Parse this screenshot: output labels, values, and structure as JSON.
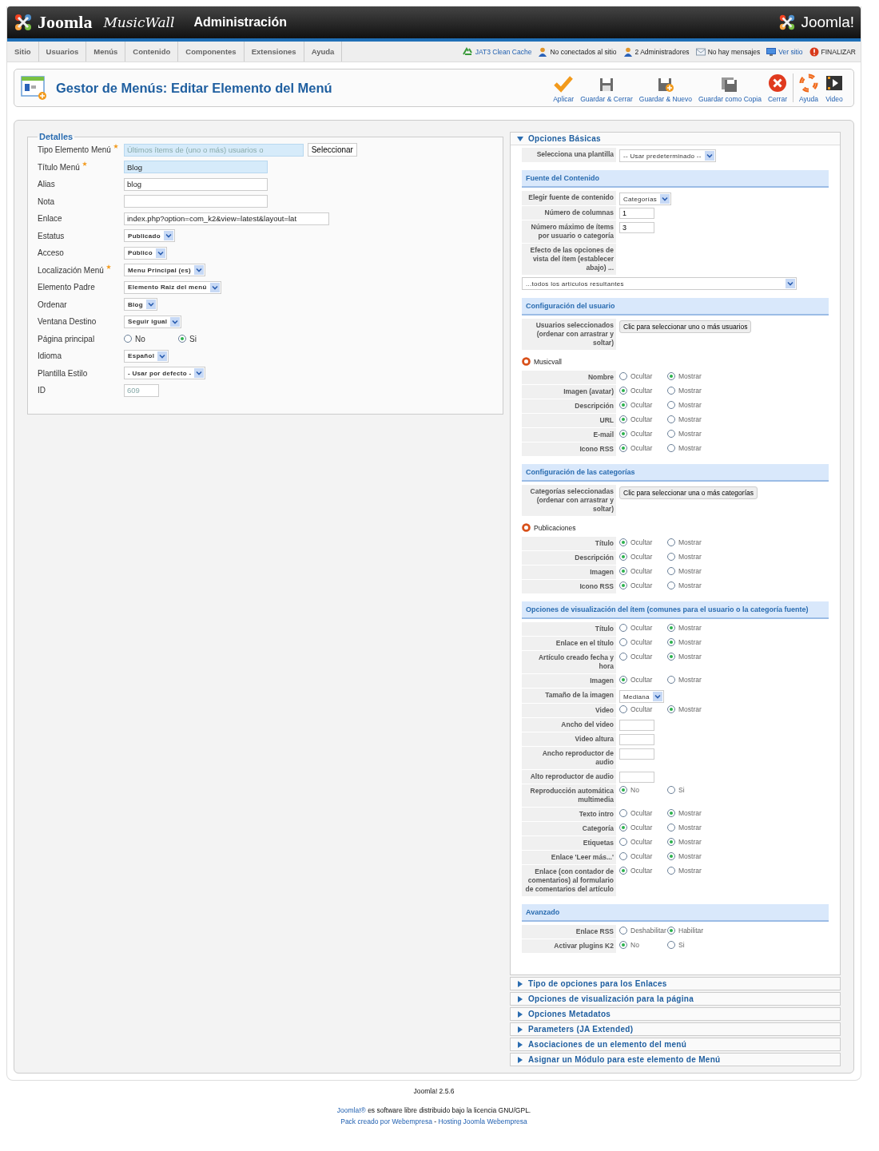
{
  "header": {
    "brand": "Joomla",
    "site_logo": "MusicWall",
    "title": "Administración",
    "right_logo": "Joomla!"
  },
  "menu": [
    "Sitio",
    "Usuarios",
    "Menús",
    "Contenido",
    "Componentes",
    "Extensiones",
    "Ayuda"
  ],
  "status": [
    {
      "label": "JAT3 Clean Cache",
      "kind": "link"
    },
    {
      "label": "No conectados al sitio",
      "kind": "text"
    },
    {
      "label": "2 Administradores",
      "kind": "text"
    },
    {
      "label": "No hay mensajes",
      "kind": "text"
    },
    {
      "label": "Ver sitio",
      "kind": "link"
    },
    {
      "label": "FINALIZAR",
      "kind": "text"
    }
  ],
  "toolbar": {
    "title": "Gestor de Menús: Editar Elemento del Menú",
    "buttons": [
      {
        "label": "Aplicar"
      },
      {
        "label": "Guardar & Cerrar"
      },
      {
        "label": "Guardar & Nuevo"
      },
      {
        "label": "Guardar como Copia"
      },
      {
        "label": "Cerrar"
      },
      {
        "label": "Ayuda"
      },
      {
        "label": "Video"
      }
    ]
  },
  "details": {
    "legend": "Detalles",
    "fields": [
      {
        "kind": "picker",
        "label": "Tipo Elemento Menú",
        "required": true,
        "value": "Últimos ítems de (uno o más) usuarios o",
        "button": "Seleccionar"
      },
      {
        "kind": "text",
        "label": "Título Menú",
        "required": true,
        "value": "Blog",
        "highlighted": true
      },
      {
        "kind": "text",
        "label": "Alias",
        "value": "blog",
        "highlighted": false
      },
      {
        "kind": "text",
        "label": "Nota",
        "highlighted": false
      },
      {
        "kind": "text",
        "label": "Enlace",
        "value": "index.php?option=com_k2&view=latest&layout=lat",
        "highlighted": false
      },
      {
        "kind": "select",
        "label": "Estatus",
        "value": "Publicado"
      },
      {
        "kind": "select",
        "label": "Acceso",
        "value": "Público"
      },
      {
        "kind": "select",
        "label": "Localización Menú",
        "required": true,
        "value": "Menu Principal (es)"
      },
      {
        "kind": "select",
        "label": "Elemento Padre",
        "value": "Elemento Raiz del menú"
      },
      {
        "kind": "select",
        "label": "Ordenar",
        "value": "Blog"
      },
      {
        "kind": "select",
        "label": "Ventana Destino",
        "value": "Seguir igual"
      },
      {
        "kind": "radio",
        "label": "Página principal",
        "options": [
          {
            "label": "No",
            "selected": false
          },
          {
            "label": "Si",
            "selected": true
          }
        ]
      },
      {
        "kind": "select",
        "label": "Idioma",
        "value": "Español"
      },
      {
        "kind": "select",
        "label": "Plantilla Estilo",
        "value": "- Usar por defecto -"
      },
      {
        "kind": "readonly",
        "label": "ID",
        "value": "609"
      }
    ]
  },
  "panels": [
    {
      "title": "Opciones Básicas",
      "expanded": true,
      "rows": [
        {
          "kind": "select",
          "label": "Selecciona una plantilla",
          "value": "-- Usar predeterminado --"
        },
        {
          "kind": "heading",
          "text": "Fuente del Contenido"
        },
        {
          "kind": "select",
          "label": "Elegir fuente de contenido",
          "value": "Categorías"
        },
        {
          "kind": "text",
          "label": "Número de columnas",
          "value": "1"
        },
        {
          "kind": "text",
          "label": "Número máximo de ítems por usuario o categoría",
          "value": "3"
        },
        {
          "kind": "label",
          "label": "Efecto de las opciones de vista del ítem (establecer abajo) ..."
        },
        {
          "kind": "wide-select",
          "value": "...todos los artículos resultantes"
        },
        {
          "kind": "heading",
          "text": "Configuración del usuario"
        },
        {
          "kind": "button",
          "label": "Usuarios seleccionados (ordenar con arrastrar y soltar)",
          "button": "Clic para seleccionar uno o más usuarios"
        },
        {
          "kind": "tag",
          "text": "Musicvall"
        },
        {
          "kind": "radio",
          "label": "Nombre",
          "options": [
            {
              "label": "Ocultar",
              "selected": false
            },
            {
              "label": "Mostrar",
              "selected": true
            }
          ]
        },
        {
          "kind": "radio",
          "label": "Imagen (avatar)",
          "options": [
            {
              "label": "Ocultar",
              "selected": true
            },
            {
              "label": "Mostrar",
              "selected": false
            }
          ]
        },
        {
          "kind": "radio",
          "label": "Descripción",
          "options": [
            {
              "label": "Ocultar",
              "selected": true
            },
            {
              "label": "Mostrar",
              "selected": false
            }
          ]
        },
        {
          "kind": "radio",
          "label": "URL",
          "options": [
            {
              "label": "Ocultar",
              "selected": true
            },
            {
              "label": "Mostrar",
              "selected": false
            }
          ]
        },
        {
          "kind": "radio",
          "label": "E-mail",
          "options": [
            {
              "label": "Ocultar",
              "selected": true
            },
            {
              "label": "Mostrar",
              "selected": false
            }
          ]
        },
        {
          "kind": "radio",
          "label": "Icono RSS",
          "options": [
            {
              "label": "Ocultar",
              "selected": true
            },
            {
              "label": "Mostrar",
              "selected": false
            }
          ]
        },
        {
          "kind": "heading",
          "text": "Configuración de las categorías"
        },
        {
          "kind": "button",
          "label": "Categorías seleccionadas (ordenar con arrastrar y soltar)",
          "button": "Clic para seleccionar una o más categorías"
        },
        {
          "kind": "tag",
          "text": "Publicaciones"
        },
        {
          "kind": "radio",
          "label": "Título",
          "options": [
            {
              "label": "Ocultar",
              "selected": true
            },
            {
              "label": "Mostrar",
              "selected": false
            }
          ]
        },
        {
          "kind": "radio",
          "label": "Descripción",
          "options": [
            {
              "label": "Ocultar",
              "selected": true
            },
            {
              "label": "Mostrar",
              "selected": false
            }
          ]
        },
        {
          "kind": "radio",
          "label": "Imagen",
          "options": [
            {
              "label": "Ocultar",
              "selected": true
            },
            {
              "label": "Mostrar",
              "selected": false
            }
          ]
        },
        {
          "kind": "radio",
          "label": "Icono RSS",
          "options": [
            {
              "label": "Ocultar",
              "selected": true
            },
            {
              "label": "Mostrar",
              "selected": false
            }
          ]
        },
        {
          "kind": "heading",
          "text": "Opciones de visualización del ítem (comunes para el usuario o la categoría fuente)"
        },
        {
          "kind": "radio",
          "label": "Título",
          "options": [
            {
              "label": "Ocultar",
              "selected": false
            },
            {
              "label": "Mostrar",
              "selected": true
            }
          ]
        },
        {
          "kind": "radio",
          "label": "Enlace en el título",
          "options": [
            {
              "label": "Ocultar",
              "selected": false
            },
            {
              "label": "Mostrar",
              "selected": true
            }
          ]
        },
        {
          "kind": "radio",
          "label": "Artículo creado fecha y hora",
          "options": [
            {
              "label": "Ocultar",
              "selected": false
            },
            {
              "label": "Mostrar",
              "selected": true
            }
          ]
        },
        {
          "kind": "radio",
          "label": "Imagen",
          "options": [
            {
              "label": "Ocultar",
              "selected": true
            },
            {
              "label": "Mostrar",
              "selected": false
            }
          ]
        },
        {
          "kind": "select",
          "label": "Tamaño de la imagen",
          "value": "Mediana"
        },
        {
          "kind": "radio",
          "label": "Video",
          "options": [
            {
              "label": "Ocultar",
              "selected": false
            },
            {
              "label": "Mostrar",
              "selected": true
            }
          ]
        },
        {
          "kind": "text",
          "label": "Ancho del video"
        },
        {
          "kind": "text",
          "label": "Video altura"
        },
        {
          "kind": "text",
          "label": "Ancho reproductor de audio"
        },
        {
          "kind": "text",
          "label": "Alto reproductor de audio"
        },
        {
          "kind": "radio",
          "label": "Reproducción automática multimedia",
          "options": [
            {
              "label": "No",
              "selected": true
            },
            {
              "label": "Si",
              "selected": false
            }
          ]
        },
        {
          "kind": "radio",
          "label": "Texto intro",
          "options": [
            {
              "label": "Ocultar",
              "selected": false
            },
            {
              "label": "Mostrar",
              "selected": true
            }
          ]
        },
        {
          "kind": "radio",
          "label": "Categoría",
          "options": [
            {
              "label": "Ocultar",
              "selected": true
            },
            {
              "label": "Mostrar",
              "selected": false
            }
          ]
        },
        {
          "kind": "radio",
          "label": "Etiquetas",
          "options": [
            {
              "label": "Ocultar",
              "selected": false
            },
            {
              "label": "Mostrar",
              "selected": true
            }
          ]
        },
        {
          "kind": "radio",
          "label": "Enlace 'Leer más...'",
          "options": [
            {
              "label": "Ocultar",
              "selected": false
            },
            {
              "label": "Mostrar",
              "selected": true
            }
          ]
        },
        {
          "kind": "radio",
          "label": "Enlace (con contador de comentarios) al formulario de comentarios del artículo",
          "options": [
            {
              "label": "Ocultar",
              "selected": true
            },
            {
              "label": "Mostrar",
              "selected": false
            }
          ]
        },
        {
          "kind": "heading",
          "text": "Avanzado"
        },
        {
          "kind": "radio",
          "label": "Enlace RSS",
          "options": [
            {
              "label": "Deshabilitar",
              "selected": false
            },
            {
              "label": "Habilitar",
              "selected": true
            }
          ]
        },
        {
          "kind": "radio",
          "label": "Activar plugins K2",
          "options": [
            {
              "label": "No",
              "selected": true
            },
            {
              "label": "Si",
              "selected": false
            }
          ]
        }
      ]
    },
    {
      "title": "Tipo de opciones para los Enlaces",
      "expanded": false
    },
    {
      "title": "Opciones de visualización para la página",
      "expanded": false
    },
    {
      "title": "Opciones Metadatos",
      "expanded": false
    },
    {
      "title": "Parameters (JA Extended)",
      "expanded": false
    },
    {
      "title": "Asociaciones de un elemento del menú",
      "expanded": false
    },
    {
      "title": "Asignar un Módulo para este elemento de Menú",
      "expanded": false
    }
  ],
  "footer": {
    "version": "Joomla! 2.5.6",
    "license_link": "Joomla!®",
    "license_text": "es software libre distribuido bajo la licencia GNU/GPL.",
    "credit_links": [
      "Pack creado por Webempresa",
      "Hosting Joomla Webempresa"
    ],
    "separator": "-"
  }
}
